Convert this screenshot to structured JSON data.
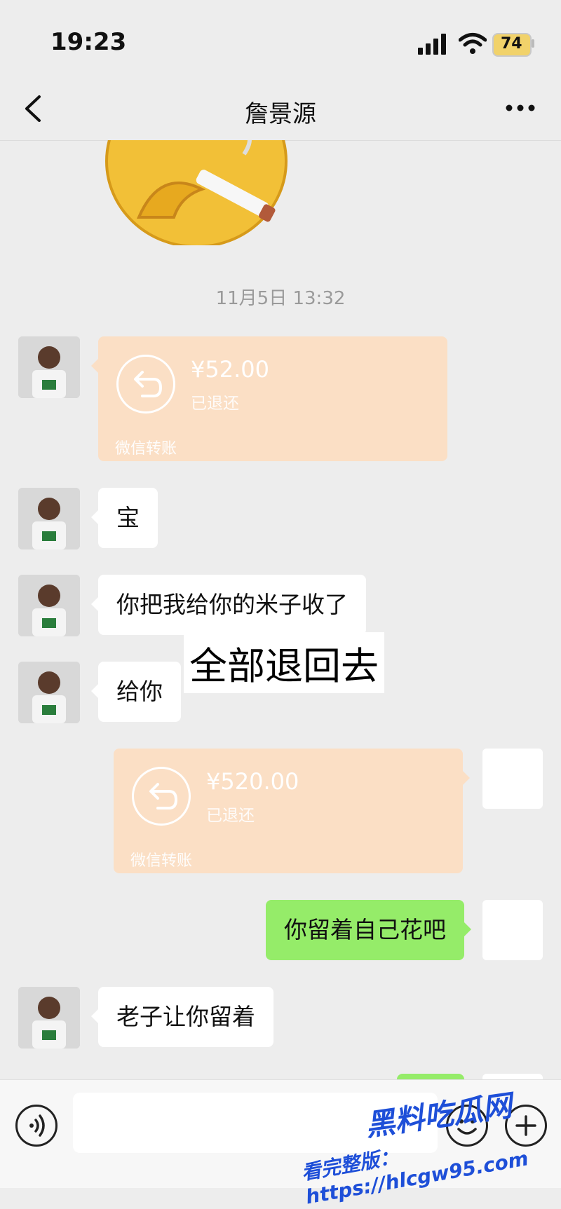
{
  "status": {
    "time": "19:23",
    "battery": "74"
  },
  "header": {
    "title": "詹景源"
  },
  "timestamp": "11月5日 13:32",
  "transfers": [
    {
      "amount": "¥52.00",
      "status": "已退还",
      "label": "微信转账"
    },
    {
      "amount": "¥520.00",
      "status": "已退还",
      "label": "微信转账"
    }
  ],
  "messages": [
    {
      "text": "宝"
    },
    {
      "text": "你把我给你的米子收了"
    },
    {
      "text": "给你"
    },
    {
      "text": "你留着自己花吧"
    },
    {
      "text": "老子让你留着"
    }
  ],
  "overlay_caption": "全部退回去",
  "watermark": {
    "title": "黑料吃瓜网",
    "subtitle": "看完整版：https://hlcgw95.com"
  },
  "colors": {
    "accent_green": "#95ec69",
    "transfer_bg": "#fbdfc5",
    "background": "#ededed"
  }
}
